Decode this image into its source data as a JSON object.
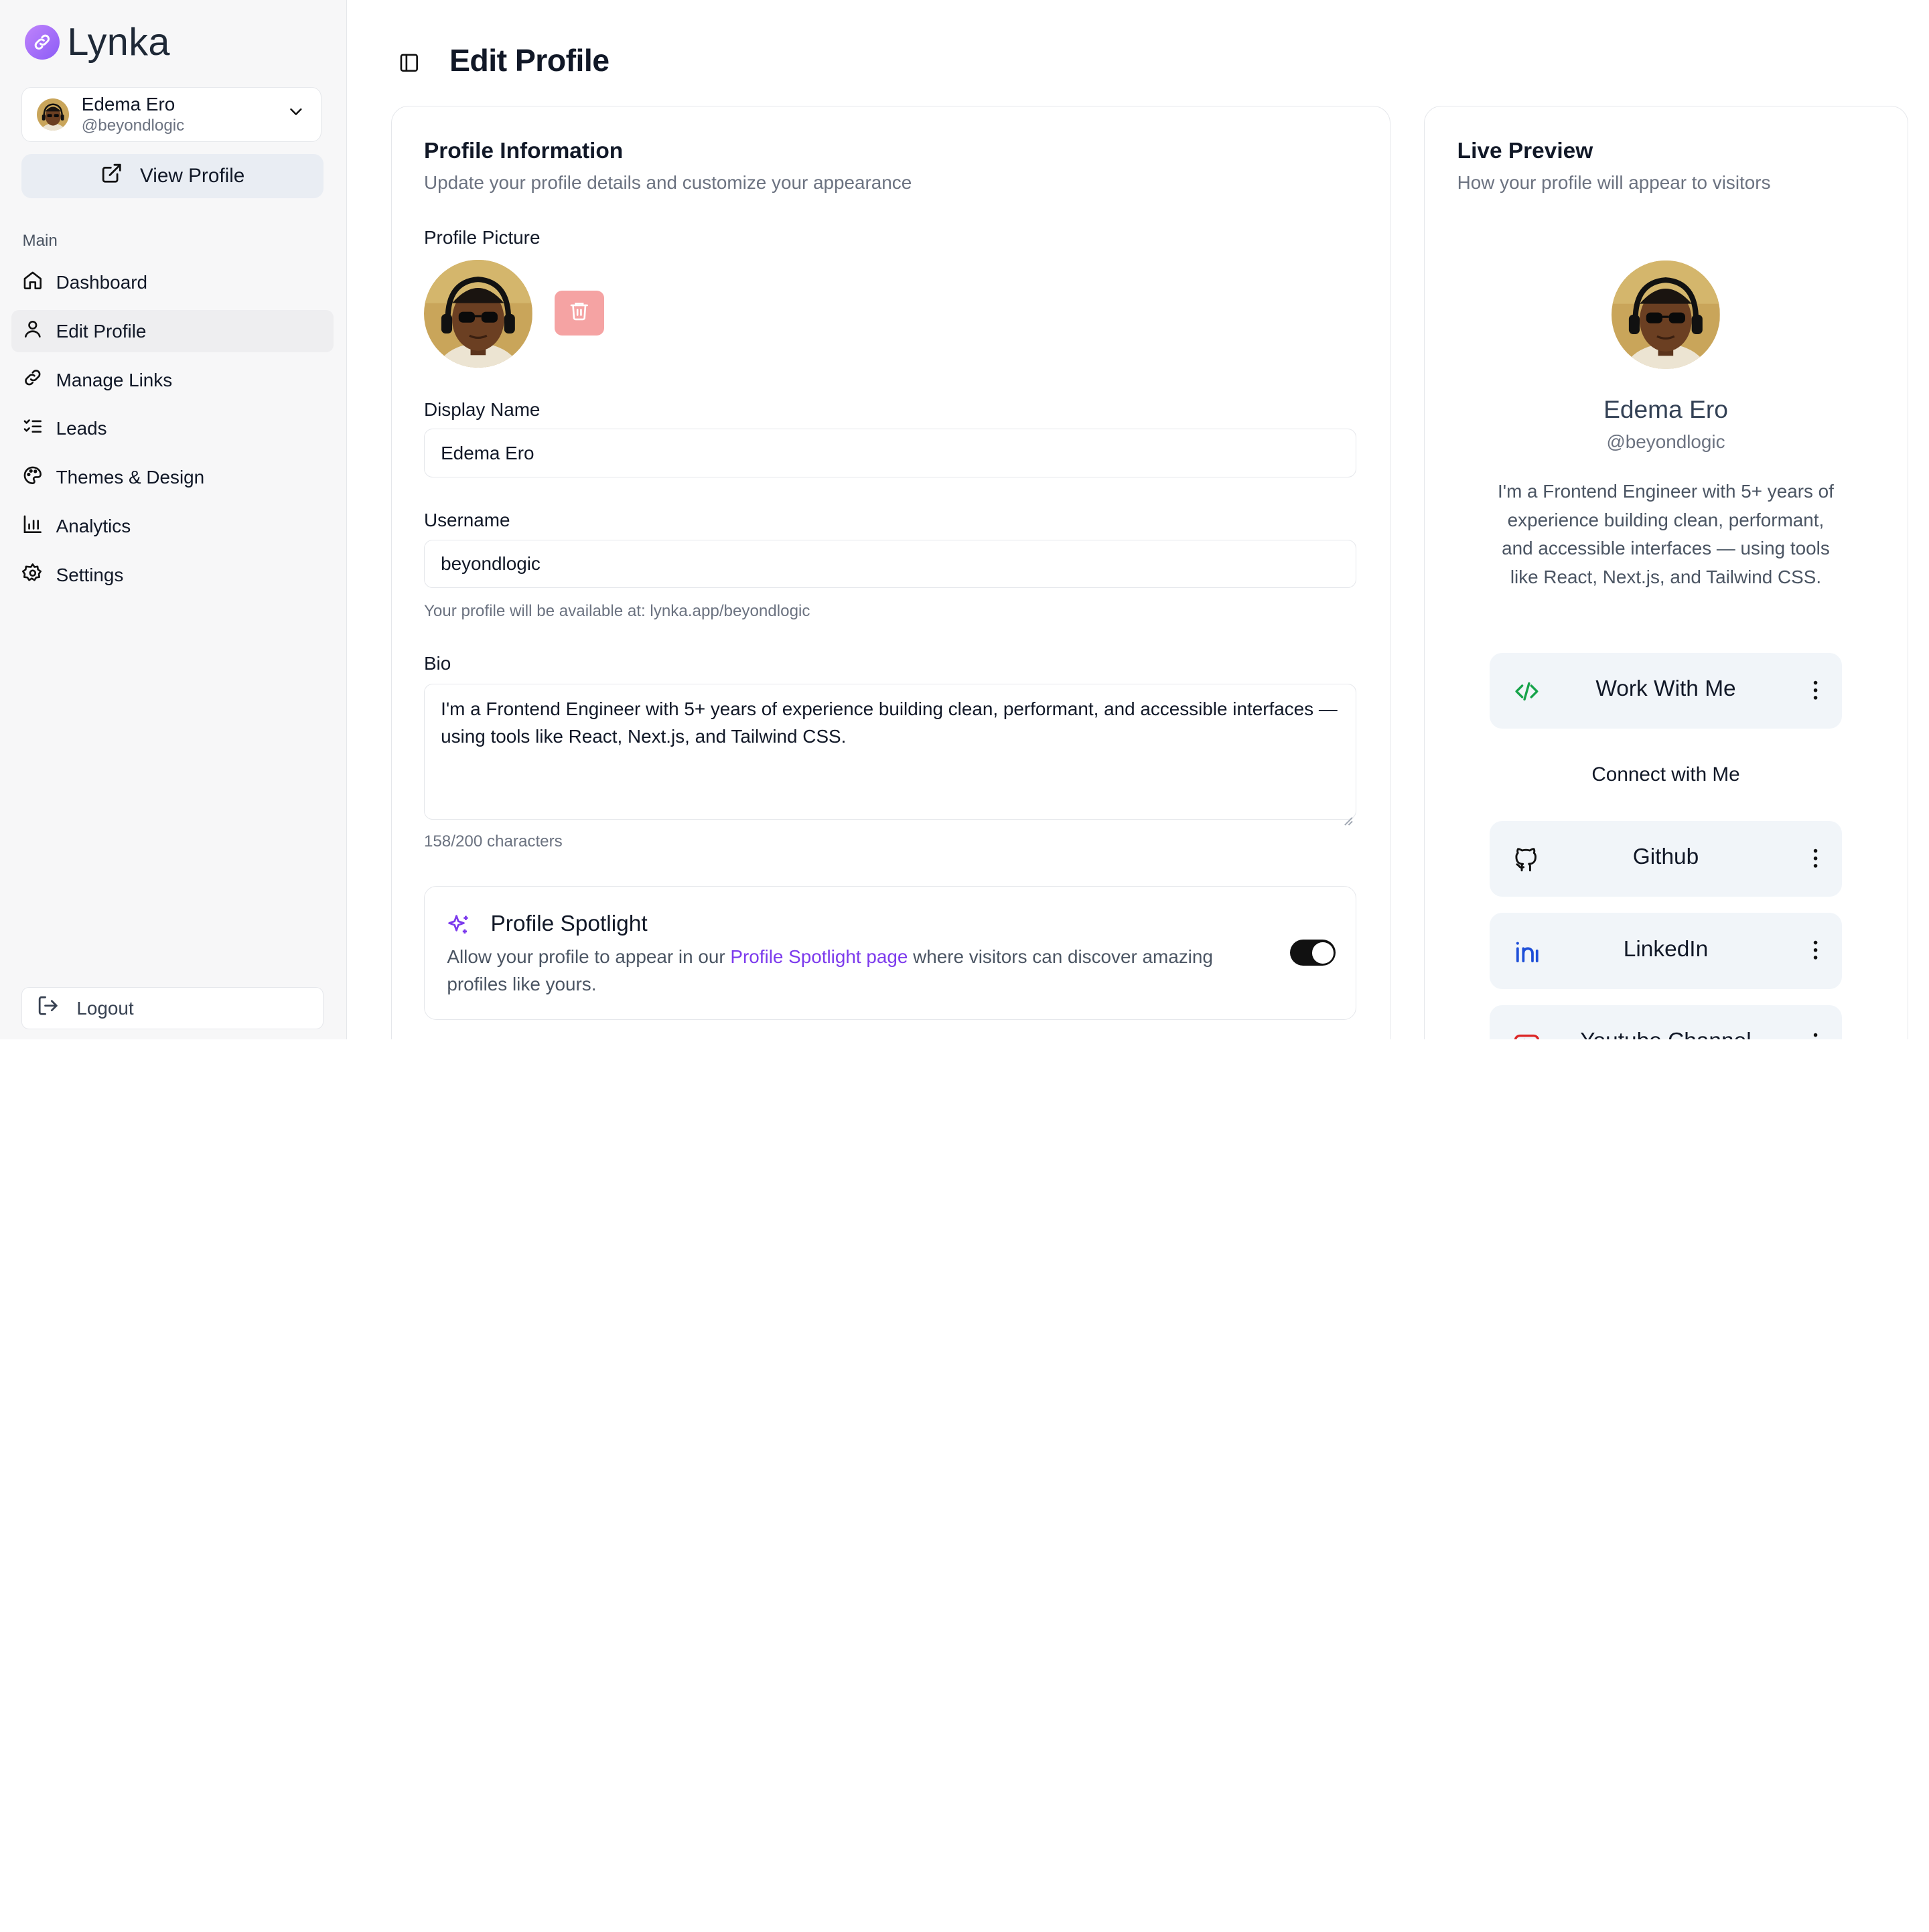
{
  "brand": {
    "name": "Lynka"
  },
  "account": {
    "name": "Edema Ero",
    "handle": "@beyondlogic"
  },
  "sidebar": {
    "view_profile": "View Profile",
    "section_label": "Main",
    "items": [
      {
        "label": "Dashboard",
        "icon": "home-icon"
      },
      {
        "label": "Edit Profile",
        "icon": "user-icon",
        "active": true
      },
      {
        "label": "Manage Links",
        "icon": "link-icon"
      },
      {
        "label": "Leads",
        "icon": "list-checks-icon"
      },
      {
        "label": "Themes & Design",
        "icon": "palette-icon"
      },
      {
        "label": "Analytics",
        "icon": "bar-chart-icon"
      },
      {
        "label": "Settings",
        "icon": "gear-icon"
      }
    ],
    "logout": "Logout"
  },
  "header": {
    "title": "Edit Profile"
  },
  "profile_form": {
    "title": "Profile Information",
    "subtitle": "Update your profile details and customize your appearance",
    "picture_label": "Profile Picture",
    "display_name_label": "Display Name",
    "display_name_value": "Edema Ero",
    "username_label": "Username",
    "username_value": "beyondlogic",
    "username_hint": "Your profile will be available at: lynka.app/beyondlogic",
    "bio_label": "Bio",
    "bio_value": "I'm a Frontend Engineer with 5+ years of experience building clean, performant, and accessible interfaces — using tools like React, Next.js, and Tailwind CSS.",
    "bio_count": "158/200 characters",
    "spotlight": {
      "title": "Profile Spotlight",
      "desc_before": "Allow your profile to appear in our ",
      "desc_link": "Profile Spotlight page",
      "desc_after": " where visitors can discover amazing profiles like yours.",
      "enabled": true
    }
  },
  "preview": {
    "title": "Live Preview",
    "subtitle": "How your profile will appear to visitors",
    "name": "Edema Ero",
    "handle": "@beyondlogic",
    "bio": "I'm a Frontend Engineer with 5+ years of experience building clean, performant, and accessible interfaces — using tools like React, Next.js, and Tailwind CSS.",
    "featured_link": "Work With Me",
    "connect_heading": "Connect with Me",
    "links": [
      "Github",
      "LinkedIn",
      "Youtube Channel"
    ]
  },
  "colors": {
    "accent": "#7c3aed",
    "danger_soft": "#f5a3a3",
    "sidebar_bg": "#f7f7f8"
  }
}
